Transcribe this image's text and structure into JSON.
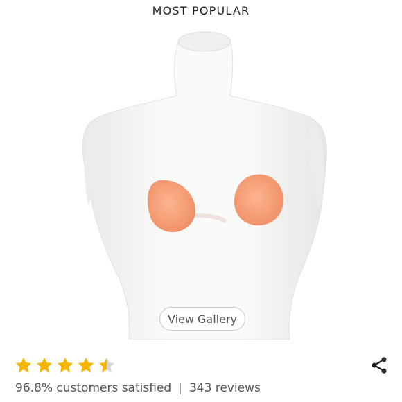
{
  "badge_label": "MOST POPULAR",
  "gallery_button_label": "View Gallery",
  "rating": {
    "value": 4.5,
    "max": 5,
    "star_color": "#f4b400",
    "empty_color": "#d6d6d6"
  },
  "summary": {
    "satisfaction": "96.8% customers satisfied",
    "separator": "|",
    "reviews": "343 reviews"
  },
  "icons": {
    "share": "share-icon",
    "star": "star-icon"
  },
  "colors": {
    "text": "#555555",
    "badge_text": "#222222",
    "product": "#f7a07a"
  }
}
